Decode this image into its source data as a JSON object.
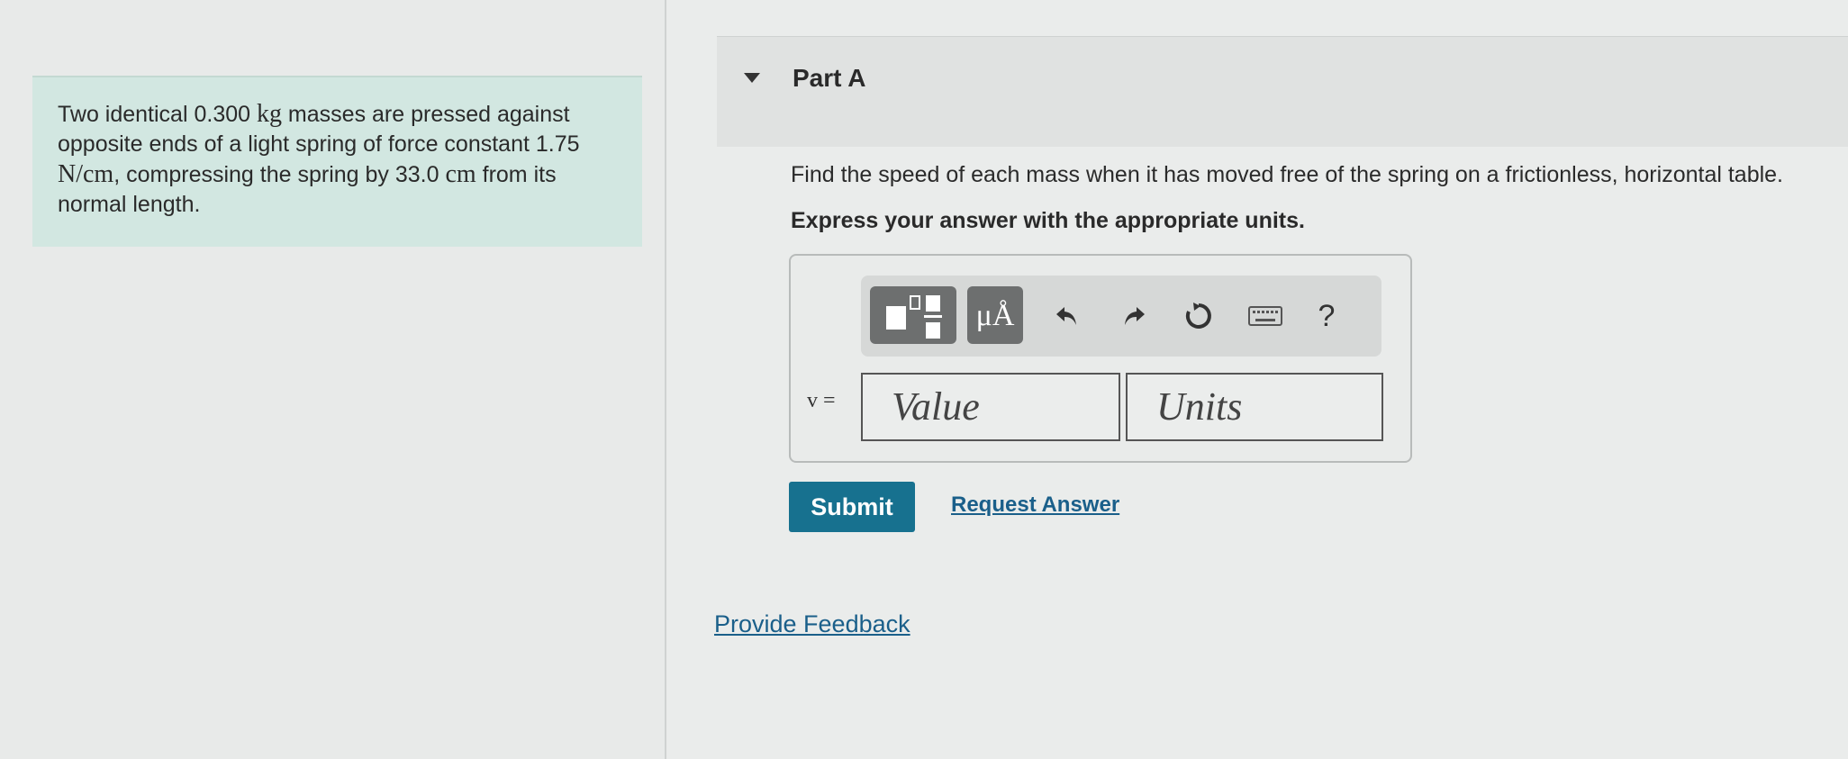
{
  "problem": {
    "segments": [
      {
        "text": "Two identical 0.300 ",
        "math": false
      },
      {
        "text": "kg",
        "math": true
      },
      {
        "text": " masses are pressed against opposite ends of a light spring of force constant 1.75 ",
        "math": false
      },
      {
        "text": "N/cm",
        "math": true
      },
      {
        "text": ", compressing the spring by 33.0 ",
        "math": false
      },
      {
        "text": "cm",
        "math": true
      },
      {
        "text": " from its normal length.",
        "math": false
      }
    ]
  },
  "part": {
    "title": "Part A",
    "question": "Find the speed of each mass when it has moved free of the spring on a frictionless, horizontal table.",
    "instruction": "Express your answer with the appropriate units."
  },
  "toolbar": {
    "units_button_label": "μÅ",
    "icons": [
      "templates-icon",
      "units-icon",
      "undo-icon",
      "redo-icon",
      "reset-icon",
      "keyboard-icon",
      "help-icon"
    ],
    "help_label": "?"
  },
  "answer": {
    "variable_label": "v =",
    "value_placeholder": "Value",
    "units_placeholder": "Units"
  },
  "actions": {
    "submit_label": "Submit",
    "request_answer_label": "Request Answer",
    "feedback_label": "Provide Feedback"
  },
  "colors": {
    "problem_bg": "#d2e7e1",
    "submit_bg": "#17718f",
    "link": "#1a5f8a"
  }
}
